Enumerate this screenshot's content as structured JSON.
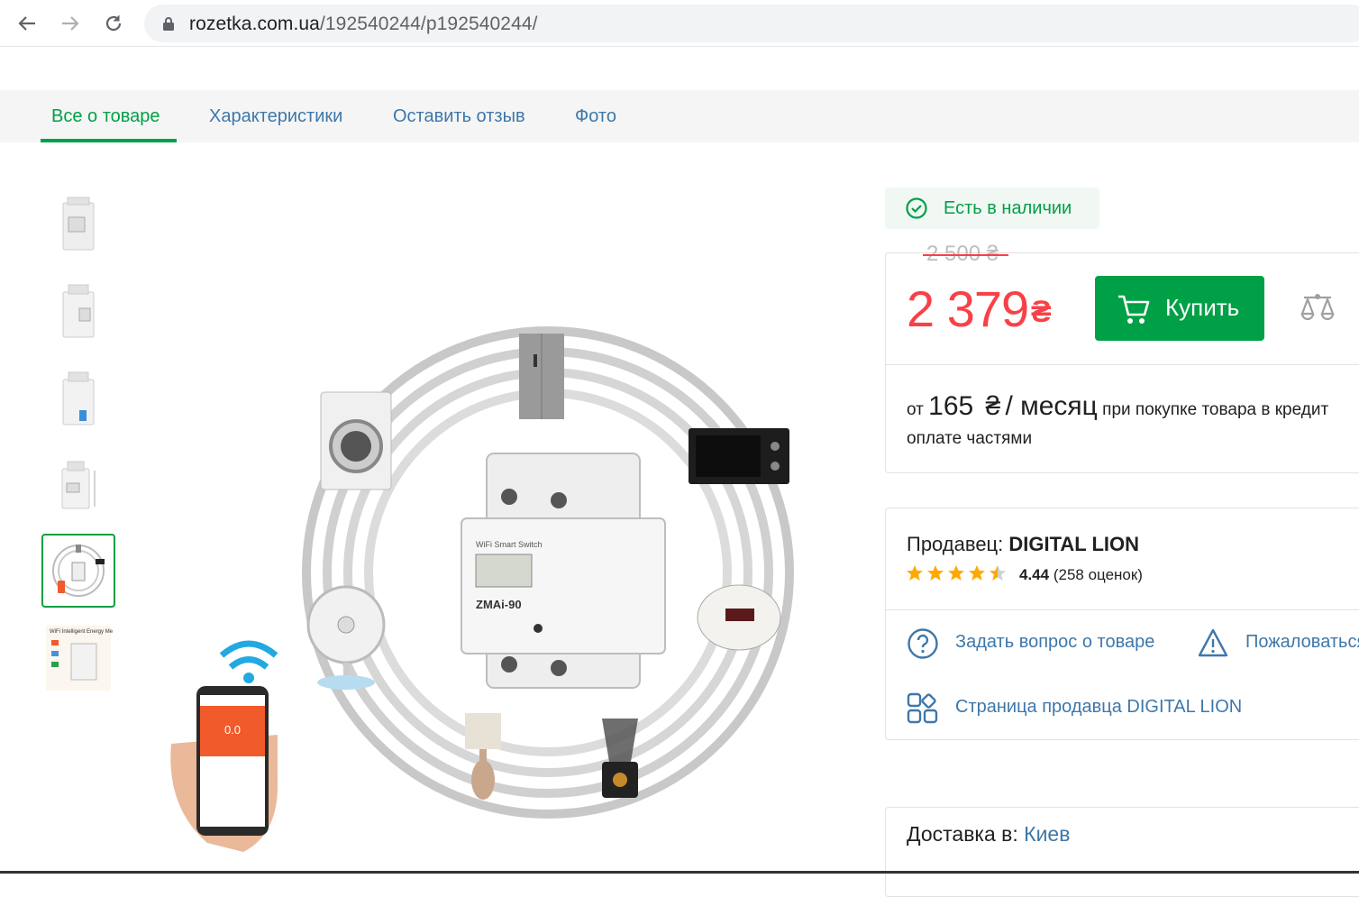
{
  "browser": {
    "url_domain": "rozetka.com.ua",
    "url_path": "/192540244/p192540244/"
  },
  "tabs": [
    {
      "label": "Все о товаре",
      "active": true
    },
    {
      "label": "Характеристики",
      "active": false
    },
    {
      "label": "Оставить отзыв",
      "active": false
    },
    {
      "label": "Фото",
      "active": false
    }
  ],
  "product": {
    "stock_status": "Есть в наличии",
    "old_price": "2 500 ₴",
    "price": "2 379",
    "currency": "₴",
    "buy_label": "Купить",
    "credit": {
      "from": "от",
      "amount": "165",
      "currency": "₴",
      "per_month": "/ месяц",
      "text": "при покупке товара в кредит",
      "text2": "оплате частями"
    },
    "image_display": "0.0"
  },
  "seller": {
    "label": "Продавец:",
    "name": "DIGITAL LION",
    "rating": "4.44",
    "reviews": "(258 оценок)",
    "stars": 4.44,
    "ask_question": "Задать вопрос о товаре",
    "complain": "Пожаловаться",
    "seller_page": "Страница продавца DIGITAL LION"
  },
  "delivery": {
    "label": "Доставка в:",
    "city": "Киев"
  },
  "colors": {
    "green": "#00a046",
    "red": "#f84147",
    "link": "#3e77aa"
  }
}
